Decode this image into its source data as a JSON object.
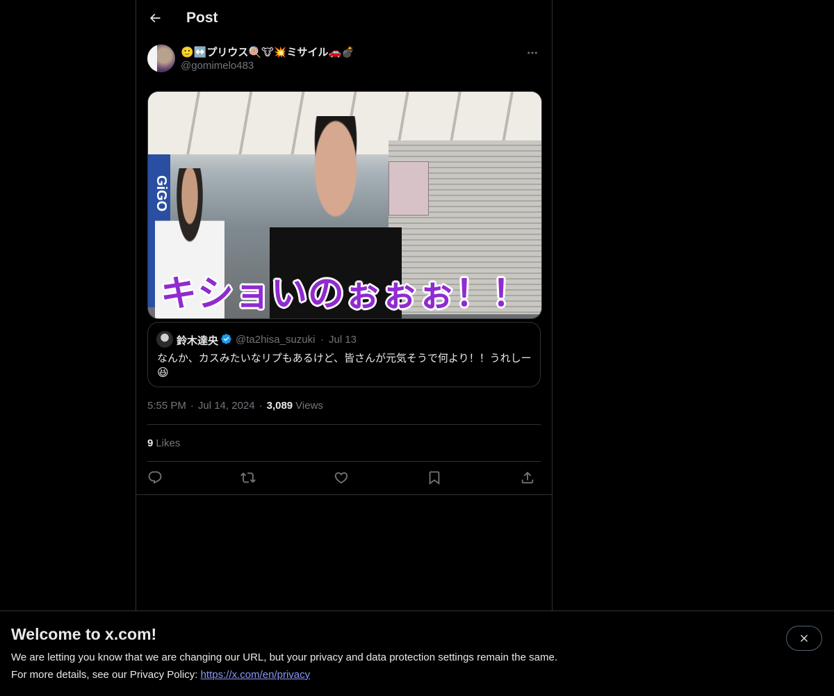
{
  "header": {
    "title": "Post",
    "back_icon": "arrow-left-icon"
  },
  "post": {
    "author": {
      "display_name": "🙂↔️プリウス🍭🐮💥ミサイル🚗💣",
      "handle": "@gomimelo483"
    },
    "media": {
      "caption": "キショいのぉぉぉ！！",
      "sign_text": "GiGO"
    },
    "quoted": {
      "name": "鈴木達央",
      "handle": "@ta2hisa_suzuki",
      "separator": "·",
      "date": "Jul 13",
      "text": "なんか、カスみたいなリプもあるけど、皆さんが元気そうで何より！！うれしー",
      "emoji": "😆",
      "verified_color": "#1d9bf0"
    },
    "meta": {
      "time": "5:55 PM",
      "sep": "·",
      "date": "Jul 14, 2024",
      "views_count": "3,089",
      "views_label": "Views"
    },
    "likes": {
      "count": "9",
      "label": "Likes"
    },
    "actions": [
      "reply-icon",
      "repost-icon",
      "like-icon",
      "bookmark-icon",
      "share-icon"
    ]
  },
  "banner": {
    "title": "Welcome to x.com!",
    "line1": "We are letting you know that we are changing our URL, but your privacy and data protection settings remain the same.",
    "line2_prefix": "For more details, see our Privacy Policy: ",
    "link": "https://x.com/en/privacy"
  },
  "colors": {
    "background": "#000000",
    "text": "#e7e9ea",
    "muted": "#71767b",
    "border": "#2f3336",
    "link": "#8b98f6",
    "caption": "#8f2bd0"
  }
}
